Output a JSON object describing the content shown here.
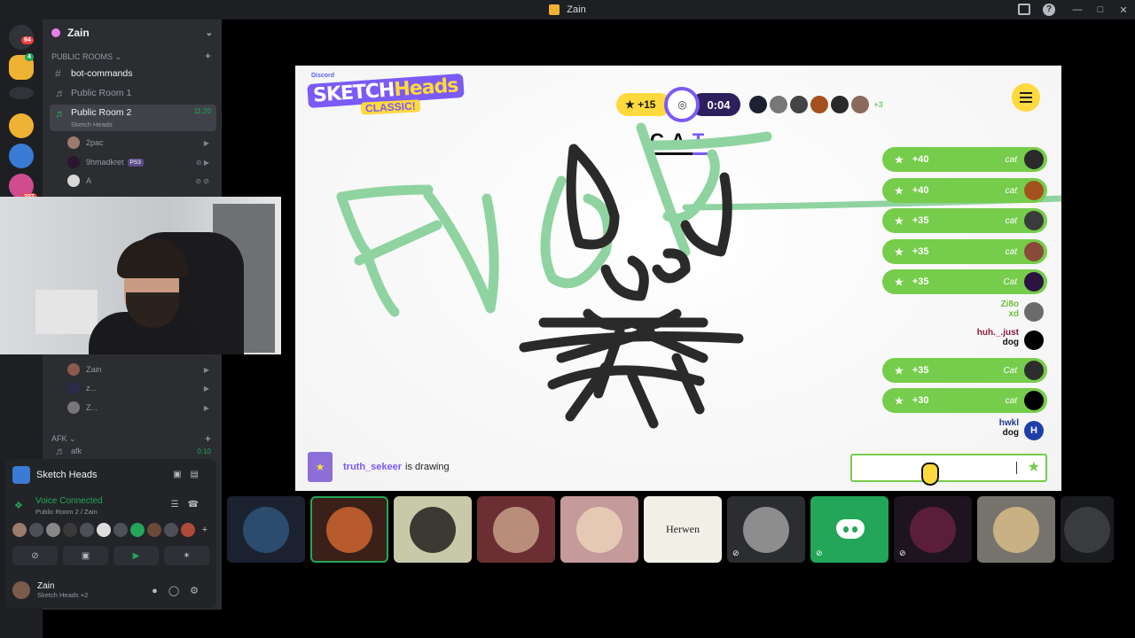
{
  "window": {
    "title": "Zain"
  },
  "rail": {
    "mentions_badge": "94",
    "second_badge": "4",
    "third_badge": "207"
  },
  "server": {
    "name": "Zain"
  },
  "sidebar": {
    "category_public": "Public Rooms",
    "channels": [
      {
        "name": "bot-commands",
        "type": "text"
      },
      {
        "name": "Public Room 1",
        "type": "voice"
      },
      {
        "name": "Public Room 2",
        "type": "voice",
        "time": "11:20",
        "activity": "Sketch Heads"
      }
    ],
    "voice_users": [
      {
        "name": "2pac"
      },
      {
        "name": "9hmadkret",
        "tag": "PS3"
      },
      {
        "name": "A"
      }
    ],
    "voice_users_lower": [
      {
        "name": "Zain"
      },
      {
        "name": "z..."
      },
      {
        "name": "Z..."
      }
    ],
    "category_afk": "AFK",
    "afk_channel": "afk",
    "afk_time": "0:10"
  },
  "activity_panel": {
    "title": "Sketch Heads",
    "voice_status": "Voice Connected",
    "voice_location": "Public Room 2 / Zain"
  },
  "user_bar": {
    "name": "Zain",
    "status": "Sketch Heads +2"
  },
  "game": {
    "brand_small": "Discord",
    "brand_sketch": "SKETCH",
    "brand_heads": "Heads",
    "brand_classic": "CLASSIC!",
    "score_bonus": "+15",
    "timer": "0:04",
    "players_more": "+3",
    "word_letters": [
      "C",
      "A",
      "T"
    ],
    "guesses": [
      {
        "kind": "correct",
        "points": "+40",
        "word": "cat",
        "avatar_color": "#2a2a2a"
      },
      {
        "kind": "correct",
        "points": "+40",
        "word": "cat",
        "avatar_color": "#a3521f"
      },
      {
        "kind": "correct",
        "points": "+35",
        "word": "cat",
        "avatar_color": "#3b3b3b"
      },
      {
        "kind": "correct",
        "points": "+35",
        "word": "cat",
        "avatar_color": "#8a4a3a"
      },
      {
        "kind": "correct",
        "points": "+35",
        "word": "Cat",
        "avatar_color": "#2b1440"
      },
      {
        "kind": "message",
        "user": "Zi8o",
        "text": "xd",
        "user_color": "#6cbf3a",
        "avatar_color": "#6b6b6b"
      },
      {
        "kind": "message",
        "user": "huh._.just",
        "text": "dog",
        "user_color": "#8a1c3a",
        "avatar_color": "#000000"
      },
      {
        "kind": "correct",
        "points": "+35",
        "word": "Cat",
        "avatar_color": "#2d2d2d"
      },
      {
        "kind": "correct",
        "points": "+30",
        "word": "cat",
        "avatar_color": "#000000"
      },
      {
        "kind": "message",
        "user": "hwkl",
        "text": "dog",
        "user_color": "#1e3a8a",
        "avatar_color": "#1e3fa8",
        "avatar_letter": "H"
      }
    ],
    "drawer": "truth_sekeer",
    "drawing_text": "is drawing",
    "input_placeholder": ""
  },
  "tiles": [
    {
      "kind": "avatar",
      "bg": "#1c2130",
      "ph": "#2b4c6e"
    },
    {
      "kind": "avatar",
      "bg": "#3a2018",
      "ph": "#b75a2c",
      "speaking": true
    },
    {
      "kind": "avatar",
      "bg": "#c7c9a8",
      "ph": "#3a3a32"
    },
    {
      "kind": "avatar",
      "bg": "#6b2f33",
      "ph": "#b88d7a"
    },
    {
      "kind": "avatar",
      "bg": "#c49a9a",
      "ph": "#e6c9b5"
    },
    {
      "kind": "text",
      "bg": "#f2efe6",
      "label": "Herwen"
    },
    {
      "kind": "avatar",
      "bg": "#2b2d31",
      "ph": "#8d8d8d",
      "muted": true
    },
    {
      "kind": "discord",
      "bg": "#23a55a",
      "muted": true
    },
    {
      "kind": "avatar",
      "bg": "#1e1420",
      "ph": "#5a1e3a",
      "muted": true
    },
    {
      "kind": "avatar",
      "bg": "#76736d",
      "ph": "#c9b184"
    },
    {
      "kind": "avatar",
      "bg": "#1a1b1e",
      "ph": "#3a3b3e"
    }
  ],
  "colors": {
    "discord_bg": "#2b2d31",
    "accent_green": "#23a55a",
    "game_green": "#76cc4b",
    "game_purple": "#7b5af5",
    "game_yellow": "#ffd93d",
    "stroke_green": "#8fd3a1",
    "stroke_dark": "#2a2a2a"
  }
}
